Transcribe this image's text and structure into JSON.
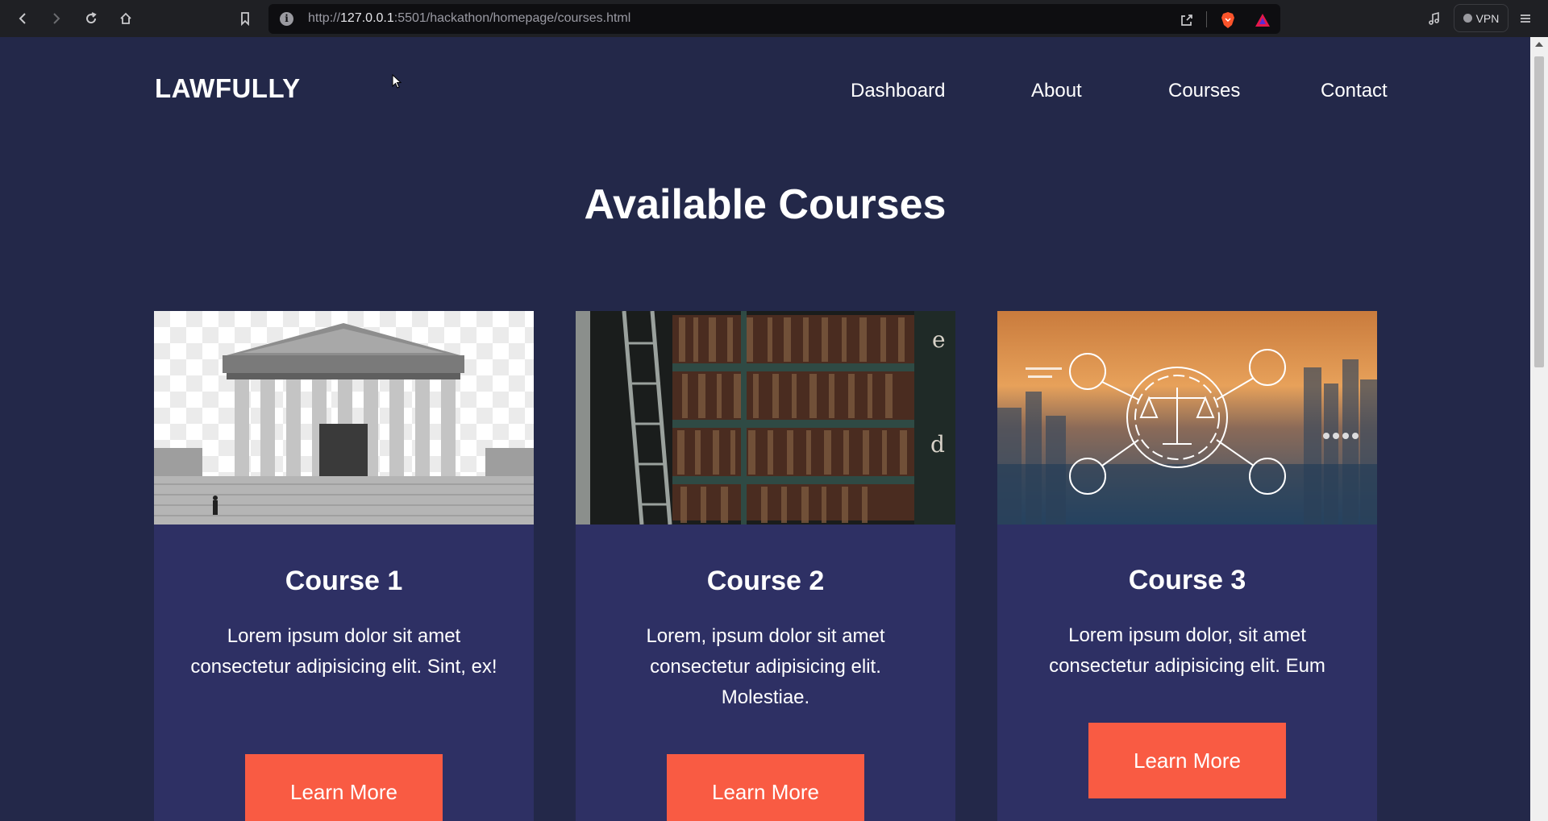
{
  "browser": {
    "url_scheme": "http://",
    "url_host": "127.0.0.1",
    "url_port_path": ":5501/hackathon/homepage/courses.html",
    "vpn_label": "VPN"
  },
  "site": {
    "logo": "LAWFULLY",
    "nav": [
      "Dashboard",
      "About",
      "Courses",
      "Contact"
    ],
    "page_title": "Available Courses"
  },
  "courses": [
    {
      "title": "Course 1",
      "text": "Lorem ipsum dolor sit amet consectetur adipisicing elit. Sint, ex!",
      "button": "Learn More",
      "image": "supreme-court-building"
    },
    {
      "title": "Course 2",
      "text": "Lorem, ipsum dolor sit amet consectetur adipisicing elit. Molestiae.",
      "button": "Learn More",
      "image": "library-bookshelf"
    },
    {
      "title": "Course 3",
      "text": "Lorem ipsum dolor, sit amet consectetur adipisicing elit. Eum",
      "button": "Learn More",
      "image": "city-justice-scales"
    }
  ],
  "colors": {
    "page_background": "#232849",
    "card_background": "#2e3064",
    "button_accent": "#f95b43",
    "chrome_background": "#1f2024"
  }
}
